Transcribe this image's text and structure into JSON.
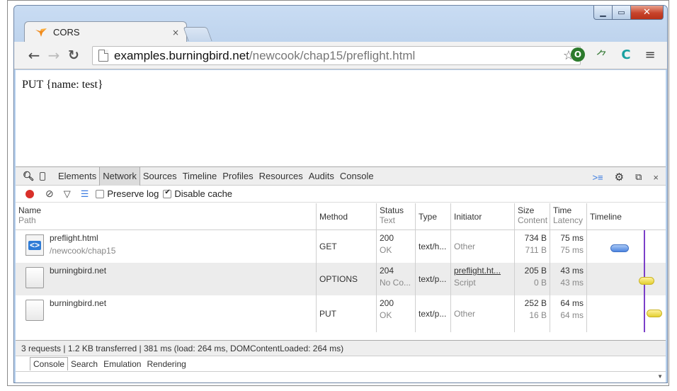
{
  "browser": {
    "tab_title": "CORS",
    "tab_close": "×",
    "url_host": "examples.burningbird.net",
    "url_path": "/newcook/chap15/preflight.html",
    "window_controls": {
      "min": "▁",
      "max": "▭",
      "close": "✕"
    }
  },
  "page": {
    "text": "PUT {name: test}"
  },
  "devtools": {
    "tabs": [
      "Elements",
      "Network",
      "Sources",
      "Timeline",
      "Profiles",
      "Resources",
      "Audits",
      "Console"
    ],
    "active_tab": "Network",
    "toolbar": {
      "preserve_log": "Preserve log",
      "disable_cache": "Disable cache"
    },
    "columns": {
      "name": "Name",
      "path": "Path",
      "method": "Method",
      "status": "Status",
      "text": "Text",
      "type": "Type",
      "initiator": "Initiator",
      "size": "Size",
      "content": "Content",
      "time": "Time",
      "latency": "Latency",
      "timeline": "Timeline"
    },
    "rows": [
      {
        "name": "preflight.html",
        "path": "/newcook/chap15",
        "method": "GET",
        "status": "200",
        "status_text": "OK",
        "type": "text/h...",
        "initiator": "Other",
        "initiator_sub": "",
        "size": "734 B",
        "content": "711 B",
        "time": "75 ms",
        "latency": "75 ms"
      },
      {
        "name": "burningbird.net",
        "path": "",
        "method": "OPTIONS",
        "status": "204",
        "status_text": "No Co...",
        "type": "text/p...",
        "initiator": "preflight.ht...",
        "initiator_sub": "Script",
        "size": "205 B",
        "content": "0 B",
        "time": "43 ms",
        "latency": "43 ms"
      },
      {
        "name": "burningbird.net",
        "path": "",
        "method": "PUT",
        "status": "200",
        "status_text": "OK",
        "type": "text/p...",
        "initiator": "Other",
        "initiator_sub": "",
        "size": "252 B",
        "content": "16 B",
        "time": "64 ms",
        "latency": "64 ms"
      }
    ],
    "summary": "3 requests  |  1.2 KB transferred  |  381 ms (load: 264 ms, DOMContentLoaded: 264 ms)",
    "drawer_tabs": [
      "Console",
      "Search",
      "Emulation",
      "Rendering"
    ]
  }
}
